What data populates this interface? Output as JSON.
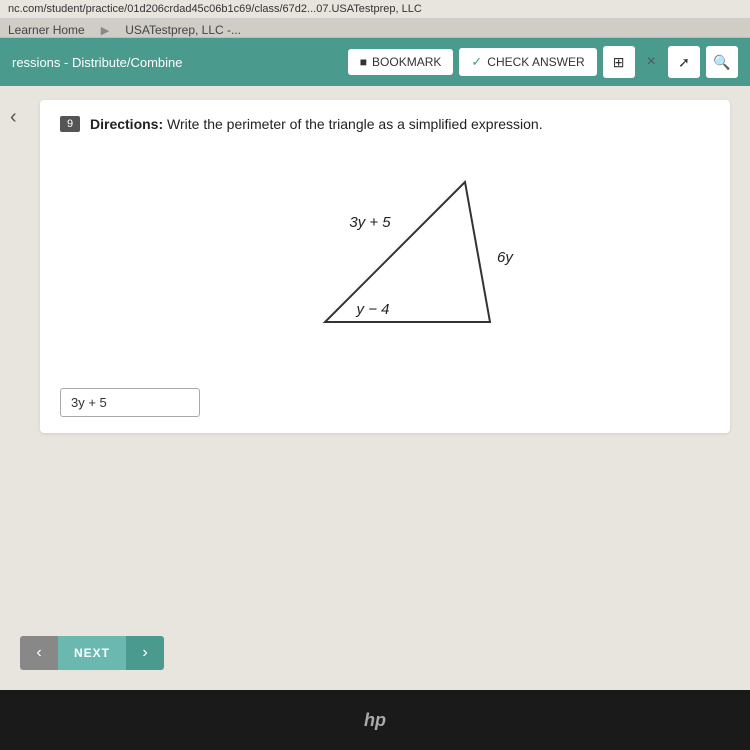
{
  "browser": {
    "url": "nc.com/student/practice/01d206crdad45c06b1c69/class/67d2...07.USATestprep, LLC",
    "tabs": [
      {
        "label": "Learner Home"
      },
      {
        "label": "USATestprep, LLC -..."
      }
    ]
  },
  "header": {
    "section_label": "ressions - Distribute/Combine",
    "bookmark_label": "BOOKMARK",
    "check_answer_label": "CHECK ANSWER",
    "close_label": "×"
  },
  "question": {
    "number": "9",
    "directions_prefix": "Directions: ",
    "directions_text": "Write the perimeter of the triangle as a simplified expression.",
    "triangle": {
      "sides": [
        {
          "label": "3y + 5",
          "position": "top"
        },
        {
          "label": "6y",
          "position": "right"
        },
        {
          "label": "y − 4",
          "position": "bottom-left"
        }
      ]
    },
    "answer_input_value": "3y + 5"
  },
  "navigation": {
    "prev_icon": "‹",
    "next_label": "NEXT",
    "next_icon": "›"
  },
  "laptop": {
    "brand": "hp"
  }
}
